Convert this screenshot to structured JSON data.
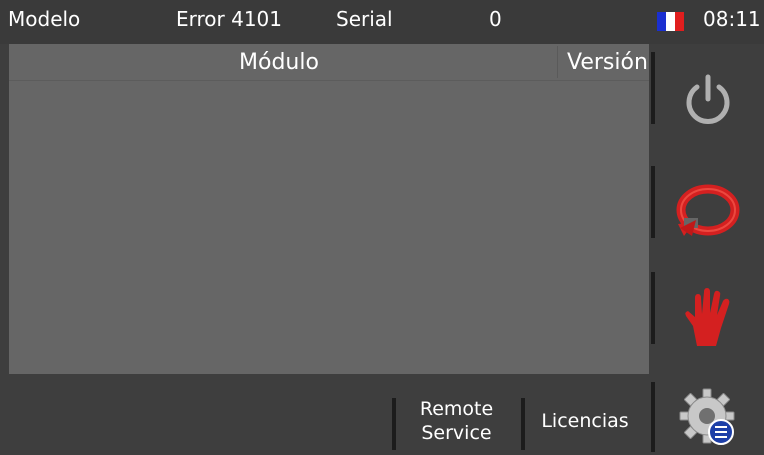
{
  "status_bar": {
    "model_label": "Modelo",
    "error_text": "Error 4101",
    "serial_label": "Serial",
    "serial_value": "0",
    "language_flag": "france-flag",
    "time": "08:11"
  },
  "module_table": {
    "columns": [
      "Módulo",
      "Versión"
    ],
    "rows": []
  },
  "side_buttons": [
    {
      "name": "power",
      "icon": "power-icon"
    },
    {
      "name": "restart",
      "icon": "restart-arrow-icon"
    },
    {
      "name": "stop",
      "icon": "stop-hand-icon"
    },
    {
      "name": "settings",
      "icon": "gear-list-icon"
    }
  ],
  "bottom_buttons": {
    "remote_service_line1": "Remote",
    "remote_service_line2": "Service",
    "licenses": "Licencias"
  },
  "colors": {
    "background": "#3e3e3e",
    "table": "#666666",
    "accent_red": "#d42020",
    "power_grey": "#b0b0b0"
  }
}
